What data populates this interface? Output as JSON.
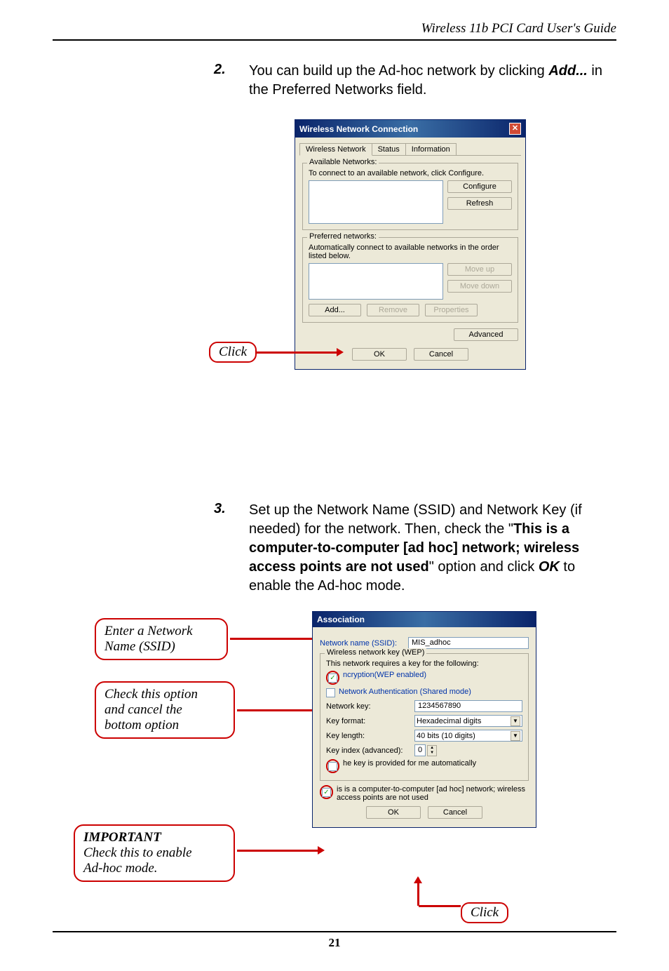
{
  "header": {
    "title": "Wireless 11b PCI Card User's Guide"
  },
  "step2": {
    "num": "2.",
    "text_a": "You can build up the Ad-hoc network by clicking ",
    "add": "Add...",
    "text_b": " in the Preferred Networks field."
  },
  "dialog1": {
    "title": "Wireless Network Connection",
    "tabs": [
      "Wireless Network",
      "Status",
      "Information"
    ],
    "available_legend": "Available Networks:",
    "available_text": "To connect to an available network, click Configure.",
    "btn_configure": "Configure",
    "btn_refresh": "Refresh",
    "preferred_legend": "Preferred networks:",
    "preferred_text": "Automatically connect to available networks in the order listed below.",
    "btn_moveup": "Move up",
    "btn_movedown": "Move down",
    "btn_add": "Add...",
    "btn_remove": "Remove",
    "btn_props": "Properties",
    "btn_advanced": "Advanced",
    "btn_ok": "OK",
    "btn_cancel": "Cancel"
  },
  "callout_click": "Click",
  "step3": {
    "num": "3.",
    "text_a": "Set up the Network Name (SSID) and Network Key (if needed) for the network.  Then, check the \"",
    "bold": "This is a computer-to-computer [ad hoc] network; wireless access points are not used",
    "text_b": "\" option and click ",
    "ok": "OK",
    "text_c": " to enable the Ad-hoc mode."
  },
  "callouts": {
    "cb1a": "Enter a Network",
    "cb1b": "Name (SSID)",
    "cb2a": "Check this option",
    "cb2b": "and cancel the",
    "cb2c": "bottom option",
    "cb3_imp": "IMPORTANT",
    "cb3a": "Check this to enable",
    "cb3b": "Ad-hoc mode."
  },
  "dialog2": {
    "title": "Association",
    "label_ssid": "Network name (SSID):",
    "val_ssid": "MIS_adhoc",
    "wep_legend": "Wireless network key (WEP)",
    "wep_text": "This network requires a key for the following:",
    "chk_encrypt": "ncryption(WEP enabled)",
    "chk_auth": "Network Authentication (Shared mode)",
    "label_key": "Network key:",
    "val_key": "1234567890",
    "label_format": "Key format:",
    "val_format": "Hexadecimal digits",
    "label_length": "Key length:",
    "val_length": "40 bits (10 digits)",
    "label_index": "Key index (advanced):",
    "val_index": "0",
    "chk_autokey": "he key is provided for me automatically",
    "chk_adhoc": "is is a computer-to-computer [ad hoc] network; wireless access points are not used",
    "btn_ok": "OK",
    "btn_cancel": "Cancel"
  },
  "page_num": "21"
}
